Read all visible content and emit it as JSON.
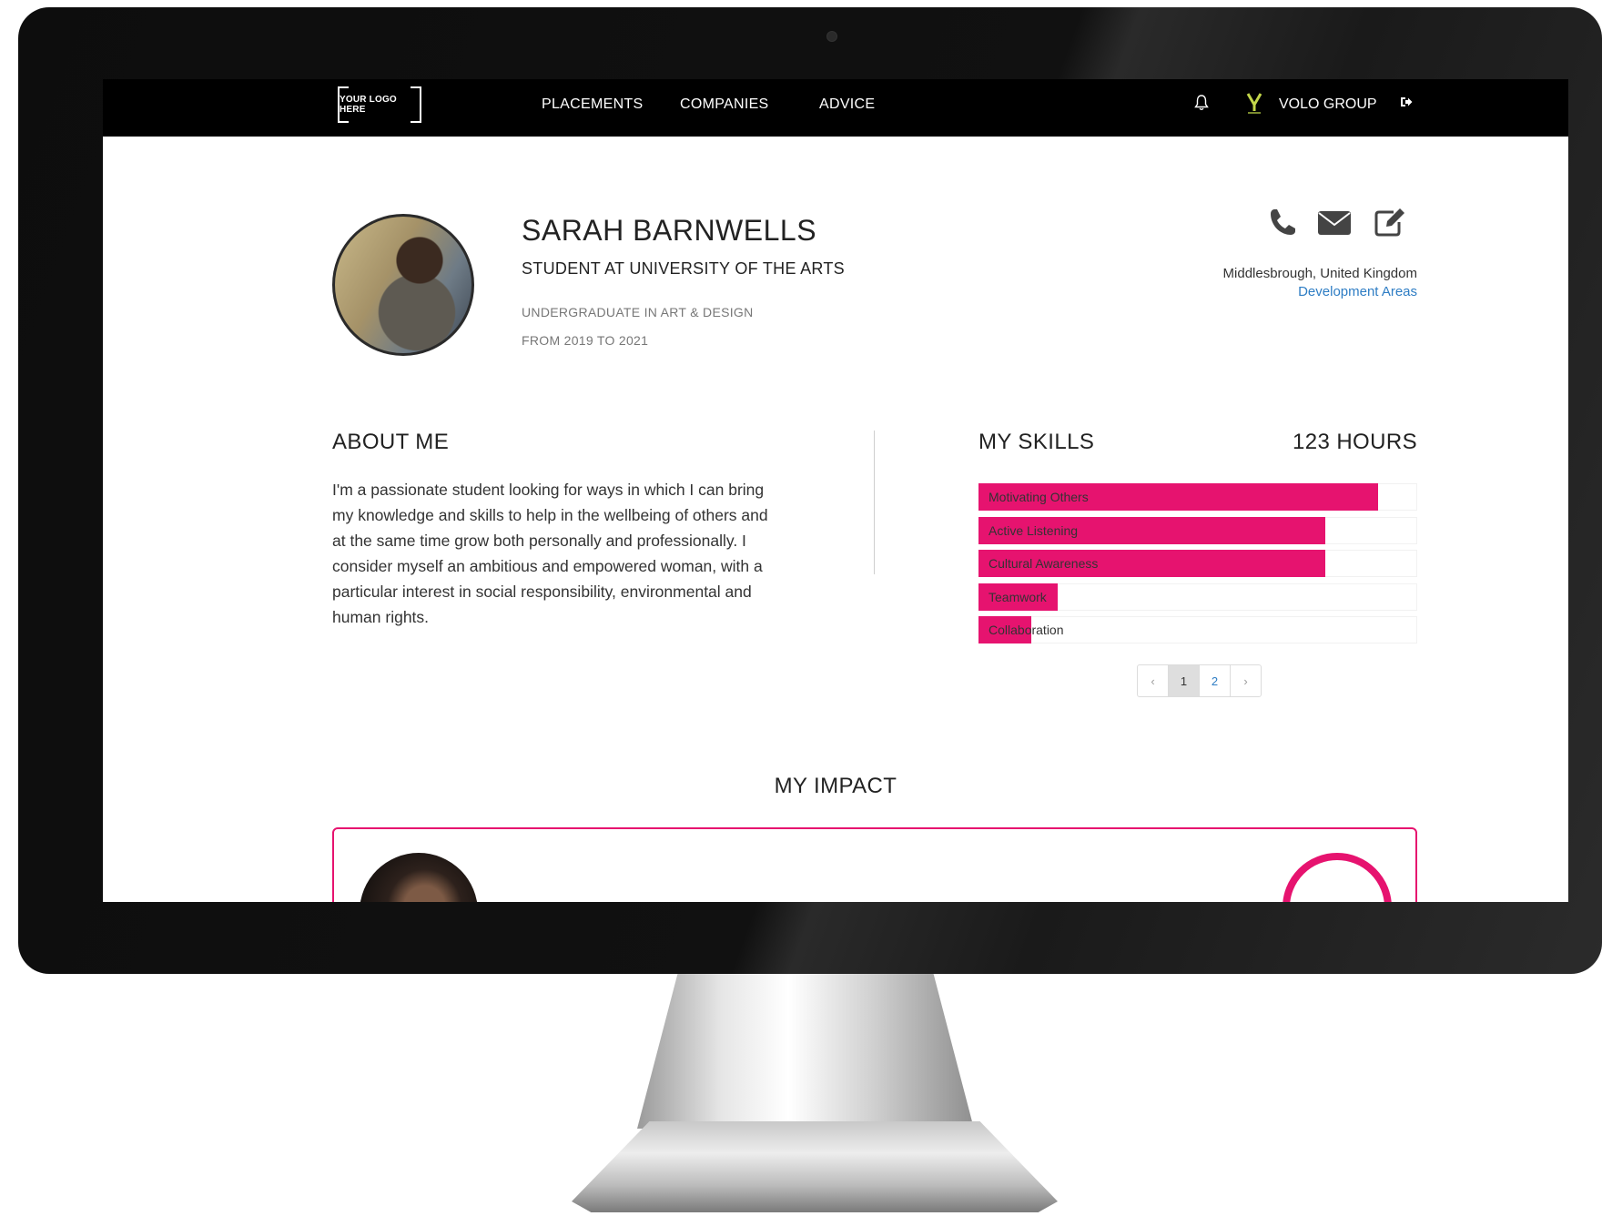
{
  "nav": {
    "logo_text": "YOUR LOGO HERE",
    "links": [
      "PLACEMENTS",
      "COMPANIES",
      "ADVICE"
    ],
    "org_name": "VOLO GROUP",
    "icons": [
      "bell-icon",
      "org-logo-icon",
      "logout-icon"
    ]
  },
  "profile": {
    "name": "SARAH BARNWELLS",
    "role": "STUDENT AT UNIVERSITY OF THE ARTS",
    "degree": "UNDERGRADUATE IN ART & DESIGN",
    "period": "FROM 2019 TO 2021",
    "location": "Middlesbrough, United Kingdom",
    "development_link": "Development Areas",
    "contact_icons": [
      "phone-icon",
      "email-icon",
      "edit-icon"
    ]
  },
  "about": {
    "title": "ABOUT ME",
    "text": "I'm a passionate student looking for ways in which I can bring my knowledge and skills to help in the wellbeing of others and at the same time grow both personally and professionally. I consider myself an ambitious and empowered woman, with a particular interest in social responsibility, environmental and human rights."
  },
  "skills": {
    "title": "MY SKILLS",
    "hours": "123 HOURS",
    "items": [
      {
        "label": "Motivating Others",
        "level": 0.91
      },
      {
        "label": "Active Listening",
        "level": 0.79
      },
      {
        "label": "Cultural Awareness",
        "level": 0.79
      },
      {
        "label": "Teamwork",
        "level": 0.18
      },
      {
        "label": "Collaboration",
        "level": 0.12
      }
    ],
    "pager": {
      "prev": "‹",
      "pages": [
        "1",
        "2"
      ],
      "current": "1",
      "next": "›"
    }
  },
  "impact": {
    "title": "MY IMPACT"
  },
  "colors": {
    "accent": "#e6136f",
    "link": "#2e7dc4",
    "nav_bg": "#000000"
  }
}
